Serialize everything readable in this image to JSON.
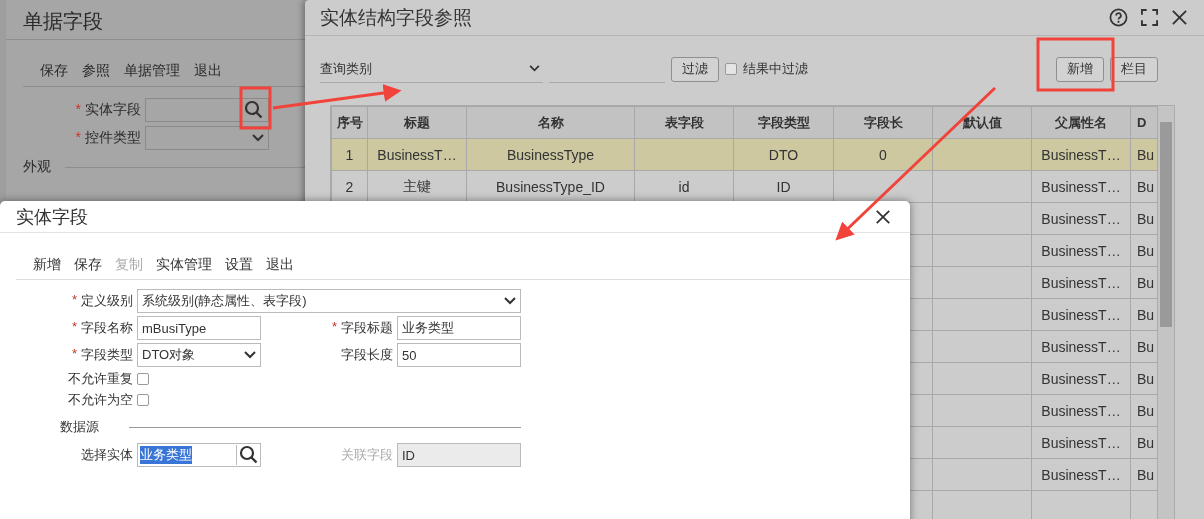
{
  "document_field_dialog": {
    "title": "单据字段",
    "toolbar": [
      "保存",
      "参照",
      "单据管理",
      "退出"
    ],
    "fields": [
      {
        "label": "实体字段",
        "required_mark": "*",
        "kind": "search"
      },
      {
        "label": "控件类型",
        "required_mark": "*",
        "kind": "select"
      }
    ],
    "section": "外观"
  },
  "reference_dialog": {
    "title": "实体结构字段参照",
    "query_select": "查询类别",
    "filter_button": "过滤",
    "filter_in_results": {
      "label": "结果中过滤",
      "checked": false
    },
    "buttons": [
      "新增",
      "栏目"
    ],
    "columns": [
      "序号",
      "标题",
      "名称",
      "表字段",
      "字段类型",
      "字段长",
      "默认值",
      "父属性名",
      "D"
    ],
    "rows": [
      {
        "selected": true,
        "cells": {
          "0": "1",
          "1": "BusinessT…",
          "2": "BusinessType",
          "4": "DTO",
          "5": "0",
          "7": "BusinessT…",
          "8": "Bu"
        }
      },
      {
        "selected": false,
        "cells": {
          "0": "2",
          "1": "主键",
          "2": "BusinessType_ID",
          "3": "id",
          "4": "ID",
          "7": "BusinessT…",
          "8": "Bu"
        }
      },
      {
        "selected": false,
        "cells": {
          "7": "BusinessT…",
          "8": "Bu"
        }
      },
      {
        "selected": false,
        "cells": {
          "7": "BusinessT…",
          "8": "Bu"
        }
      },
      {
        "selected": false,
        "cells": {
          "7": "BusinessT…",
          "8": "Bu"
        }
      },
      {
        "selected": false,
        "cells": {
          "7": "BusinessT…",
          "8": "Bu"
        }
      },
      {
        "selected": false,
        "cells": {
          "7": "BusinessT…",
          "8": "Bu"
        }
      },
      {
        "selected": false,
        "cells": {
          "7": "BusinessT…",
          "8": "Bu"
        }
      },
      {
        "selected": false,
        "cells": {
          "7": "BusinessT…",
          "8": "Bu"
        }
      },
      {
        "selected": false,
        "cells": {
          "7": "BusinessT…",
          "8": "Bu"
        }
      },
      {
        "selected": false,
        "cells": {
          "7": "BusinessT…",
          "8": "Bu"
        }
      },
      {
        "selected": false,
        "cells": {}
      }
    ]
  },
  "entity_field_dialog": {
    "title": "实体字段",
    "toolbar": [
      {
        "label": "新增",
        "disabled": false
      },
      {
        "label": "保存",
        "disabled": false
      },
      {
        "label": "复制",
        "disabled": true
      },
      {
        "label": "实体管理",
        "disabled": false
      },
      {
        "label": "设置",
        "disabled": false
      },
      {
        "label": "退出",
        "disabled": false
      }
    ],
    "rows": [
      [
        {
          "label": "定义级别",
          "required_mark": "*",
          "kind": "select",
          "value": "系统级别(静态属性、表字段)"
        }
      ],
      [
        {
          "label": "字段名称",
          "required_mark": "*",
          "kind": "text",
          "value": "mBusiType"
        },
        {
          "label": "字段标题",
          "required_mark": "*",
          "kind": "text",
          "value": "业务类型"
        }
      ],
      [
        {
          "label": "字段类型",
          "required_mark": "*",
          "kind": "select",
          "value": "DTO对象"
        },
        {
          "label": "字段长度",
          "kind": "text",
          "value": "50"
        }
      ],
      [
        {
          "label": "不允许重复",
          "kind": "checkbox",
          "checked": false
        }
      ],
      [
        {
          "label": "不允许为空",
          "kind": "checkbox",
          "checked": false
        }
      ]
    ],
    "section": "数据源",
    "source_row": [
      {
        "label": "选择实体",
        "kind": "search",
        "value": "业务类型",
        "highlighted": true
      },
      {
        "label": "关联字段",
        "kind": "text",
        "value": "ID",
        "disabled": true
      }
    ]
  }
}
